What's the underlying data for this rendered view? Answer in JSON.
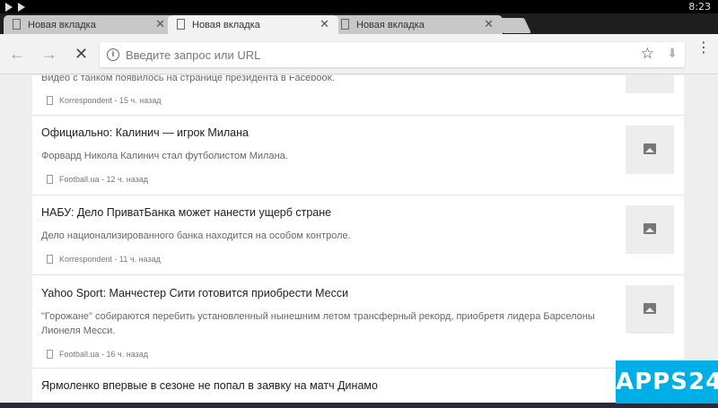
{
  "status_bar": {
    "time": "8:23"
  },
  "tabs": [
    {
      "title": "Новая вкладка",
      "close": "✕"
    },
    {
      "title": "Новая вкладка",
      "close": "✕"
    },
    {
      "title": "Новая вкладка",
      "close": "✕"
    }
  ],
  "toolbar": {
    "back_icon": "←",
    "forward_icon": "→",
    "stop_icon": "✕",
    "omnibox_placeholder": "Введите запрос или URL",
    "star_icon": "☆",
    "download_icon": "⬇",
    "menu_icon": "⋮"
  },
  "articles": [
    {
      "title": "",
      "snippet": "Видео с танком появилось на странице президента в Facebook.",
      "source": "Korrespondent - 15 ч. назад"
    },
    {
      "title": "Официально: Калинич — игрок Милана",
      "snippet": "Форвард Никола Калинич стал футболистом Милана.",
      "source": "Football.ua - 12 ч. назад"
    },
    {
      "title": "НАБУ: Дело ПриватБанка может нанести ущерб стране",
      "snippet": "Дело национализированного банка находится на особом контроле.",
      "source": "Korrespondent - 11 ч. назад"
    },
    {
      "title": "Yahoo Sport: Манчестер Сити готовится приобрести Месси",
      "snippet": "\"Горожане\" собираются перебить установленный нынешним летом трансферный рекорд, приобретя лидера Барселоны Лионеля Месси.",
      "source": "Football.ua - 16 ч. назад"
    },
    {
      "title": "Ярмоленко впервые в сезоне не попал в заявку на матч Динамо",
      "snippet": "",
      "source": ""
    }
  ],
  "watermark": {
    "text": "APPS24",
    "color": "#00aee6"
  }
}
